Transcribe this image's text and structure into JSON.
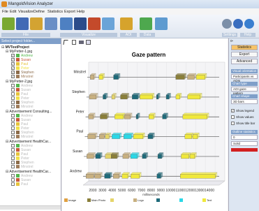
{
  "window": {
    "title": "MangoldVision Analyzer"
  },
  "menu": [
    "File",
    "Edit",
    "Visualize",
    "Define",
    "Statistics",
    "Export",
    "Help"
  ],
  "toolbar": {
    "groups": [
      "File",
      "Visualize",
      "AOI",
      "Data",
      "Settings",
      "Help"
    ],
    "buttons": [
      {
        "name": "open",
        "color": "#7aa832"
      },
      {
        "name": "save",
        "color": "#4169b5"
      },
      {
        "name": "folder",
        "color": "#d3a332"
      },
      {
        "name": "monitor",
        "color": "#6b8fc6"
      },
      {
        "name": "table",
        "color": "#4e80c2"
      },
      {
        "name": "grid",
        "color": "#2c4c8a"
      },
      {
        "name": "heatmap",
        "color": "#c44a2b"
      },
      {
        "name": "path",
        "color": "#6aa4d8"
      },
      {
        "name": "aoi",
        "color": "#d6a32c"
      },
      {
        "name": "graph",
        "color": "#4ea84e"
      },
      {
        "name": "image",
        "color": "#5e9bd0"
      },
      {
        "name": "settings",
        "color": "#7c8fa8"
      },
      {
        "name": "toggle",
        "color": "#3a6ebf"
      },
      {
        "name": "help",
        "color": "#3a7fd0"
      }
    ]
  },
  "left_panel": {
    "header": "Select project folder...",
    "root": "MVTestProject",
    "projects": [
      {
        "name": "MyPetter-1.jpg",
        "subjects": [
          {
            "name": "Andrew",
            "color": "#55b94f",
            "checked": true
          },
          {
            "name": "Susan",
            "color": "#c65b3c",
            "checked": true
          },
          {
            "name": "Paul",
            "color": "#e6c33c",
            "checked": true
          },
          {
            "name": "Peter",
            "color": "#f0e04a",
            "checked": true
          },
          {
            "name": "Stephen",
            "color": "#8b6b4a",
            "checked": true
          },
          {
            "name": "Minstrel",
            "color": "#9e7c5a",
            "checked": true
          }
        ]
      },
      {
        "name": "MyPetter-2.jpg",
        "subjects": [
          {
            "name": "Andrew",
            "color": "#55b94f",
            "checked": false
          },
          {
            "name": "Susan",
            "color": "#c65b3c",
            "checked": false
          },
          {
            "name": "Paul",
            "color": "#e6c33c",
            "checked": false
          },
          {
            "name": "Peter",
            "color": "#f0e04a",
            "checked": false
          },
          {
            "name": "Stephen",
            "color": "#8b6b4a",
            "checked": false
          },
          {
            "name": "Minstrel",
            "color": "#9e7c5a",
            "checked": false
          }
        ]
      },
      {
        "name": "Advertisement Consulting...",
        "subjects": [
          {
            "name": "Andrew",
            "color": "#55b94f",
            "checked": false
          },
          {
            "name": "Susan",
            "color": "#c65b3c",
            "checked": false
          },
          {
            "name": "Paul",
            "color": "#e6c33c",
            "checked": false
          },
          {
            "name": "Peter",
            "color": "#f0e04a",
            "checked": false
          },
          {
            "name": "Stephen",
            "color": "#8b6b4a",
            "checked": false
          },
          {
            "name": "Minstrel",
            "color": "#9e7c5a",
            "checked": false
          }
        ]
      },
      {
        "name": "Advertisement HealthCar...",
        "subjects": [
          {
            "name": "Andrew",
            "color": "#55b94f",
            "checked": false
          },
          {
            "name": "Susan",
            "color": "#c65b3c",
            "checked": false
          },
          {
            "name": "Paul",
            "color": "#e6c33c",
            "checked": false
          },
          {
            "name": "Peter",
            "color": "#f0e04a",
            "checked": false
          },
          {
            "name": "Stephen",
            "color": "#8b6b4a",
            "checked": false
          },
          {
            "name": "Minstrel",
            "color": "#9e7c5a",
            "checked": false
          }
        ]
      },
      {
        "name": "Advertisement HealthCar...",
        "subjects": [
          {
            "name": "Andrew",
            "color": "#55b94f",
            "checked": false
          },
          {
            "name": "Susan",
            "color": "#c65b3c",
            "checked": false
          },
          {
            "name": "Paul",
            "color": "#e6c33c",
            "checked": false
          }
        ]
      }
    ]
  },
  "right_panel": {
    "tabs": [
      "Statistics",
      "Export",
      "Advanced"
    ],
    "sections": [
      {
        "title": "Visual orientation",
        "value": "Participants vs AOIs"
      },
      {
        "title": "Chart type",
        "value": "AOI gaze pattern"
      },
      {
        "title": "Chart shape",
        "value": "3D bars"
      }
    ],
    "checks": [
      {
        "label": "Show legend",
        "checked": true
      },
      {
        "label": "Show values",
        "checked": false
      },
      {
        "label": "Show title bar",
        "checked": false
      }
    ],
    "outline": {
      "title": "Outline statistics",
      "value1": "0",
      "value2": "Solid",
      "color": "#d22020"
    }
  },
  "chart_data": {
    "type": "bar",
    "title": "Gaze pattern",
    "xlabel": "milliseconds",
    "xlim": [
      1000,
      15000
    ],
    "x_ticks": [
      2000,
      3000,
      4000,
      5000,
      6000,
      7000,
      8000,
      9000,
      10000,
      11000,
      12000,
      13000,
      14000
    ],
    "categories": [
      "Minstrel",
      "Stephen",
      "Peter",
      "Paul",
      "Susan",
      "Andrew"
    ],
    "series": [
      {
        "name": "Image",
        "color": "#e0a040"
      },
      {
        "name": "Main Photo",
        "color": "#8a7f3a"
      },
      {
        "name": "",
        "color": "#e5d56a"
      },
      {
        "name": "Logo",
        "color": "#c8b080"
      },
      {
        "name": "",
        "color": "#1e6a7a"
      },
      {
        "name": "",
        "color": "#2ad8e6"
      },
      {
        "name": "Text",
        "color": "#f0e83c"
      }
    ],
    "segments": {
      "Minstrel": [
        [
          1300,
          1700,
          3
        ],
        [
          2200,
          2600,
          6
        ],
        [
          3700,
          4200,
          4
        ],
        [
          10100,
          11000,
          1
        ],
        [
          11300,
          12000,
          3
        ],
        [
          12200,
          13100,
          6
        ]
      ],
      "Stephen": [
        [
          1300,
          2000,
          3
        ],
        [
          2700,
          3000,
          4
        ],
        [
          3600,
          3900,
          2
        ],
        [
          4500,
          5200,
          1
        ],
        [
          5700,
          6300,
          4
        ],
        [
          6500,
          7800,
          6
        ],
        [
          8200,
          8400,
          4
        ],
        [
          9200,
          9500,
          4
        ],
        [
          10200,
          10600,
          6
        ],
        [
          11400,
          12700,
          6
        ]
      ],
      "Peter": [
        [
          1300,
          1800,
          3
        ],
        [
          2500,
          3200,
          1
        ],
        [
          4000,
          4900,
          6
        ],
        [
          5000,
          5600,
          3
        ],
        [
          6200,
          6400,
          4
        ],
        [
          7500,
          8000,
          6
        ],
        [
          8900,
          9300,
          4
        ],
        [
          11000,
          13500,
          6
        ]
      ],
      "Paul": [
        [
          1300,
          2100,
          3
        ],
        [
          2500,
          3000,
          3
        ],
        [
          3100,
          3500,
          2
        ],
        [
          3800,
          4600,
          5
        ],
        [
          5000,
          5800,
          5
        ],
        [
          6000,
          7000,
          6
        ],
        [
          7500,
          8000,
          4
        ],
        [
          11300,
          12000,
          6
        ],
        [
          12100,
          12600,
          6
        ]
      ],
      "Susan": [
        [
          1300,
          2000,
          3
        ],
        [
          2200,
          2700,
          4
        ],
        [
          3200,
          3800,
          2
        ],
        [
          3800,
          4400,
          1
        ],
        [
          5000,
          5600,
          3
        ],
        [
          5800,
          6500,
          5
        ],
        [
          7000,
          7400,
          4
        ],
        [
          8600,
          9000,
          4
        ],
        [
          11000,
          11800,
          6
        ],
        [
          11900,
          12400,
          6
        ]
      ],
      "Andrew": [
        [
          1300,
          2100,
          3
        ],
        [
          2200,
          2800,
          3
        ],
        [
          3200,
          3800,
          4
        ],
        [
          4100,
          4700,
          3
        ],
        [
          5000,
          5600,
          6
        ],
        [
          5900,
          6800,
          6
        ],
        [
          8600,
          9000,
          4
        ],
        [
          11000,
          14600,
          6
        ]
      ]
    }
  }
}
